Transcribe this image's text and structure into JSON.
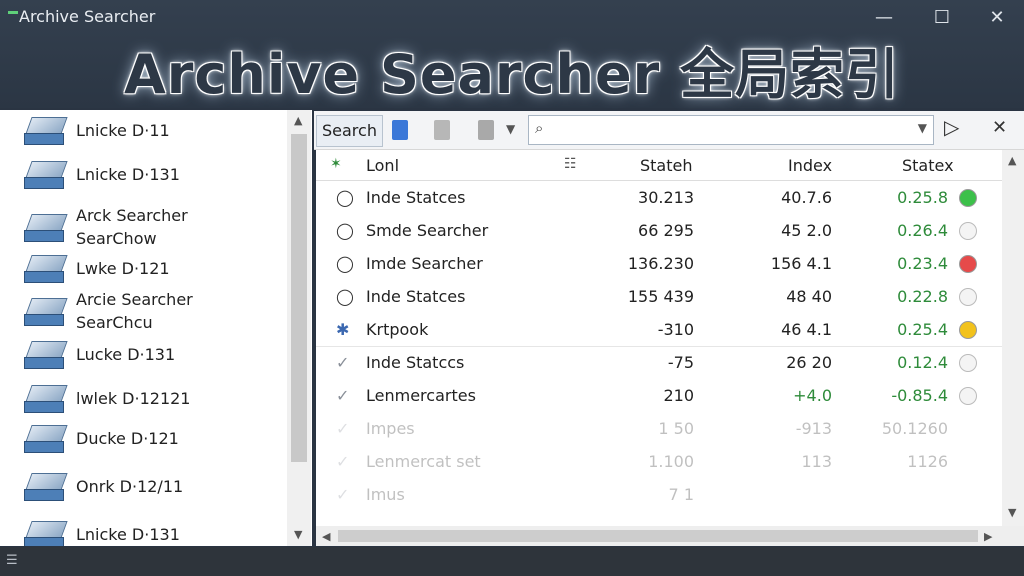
{
  "window": {
    "title": "Archive Searcher",
    "minimize": "—",
    "maximize": "☐",
    "close": "✕"
  },
  "banner": "Archive Searcher 全局索引",
  "sidebar": {
    "items": [
      {
        "label": "Lnicke D·11"
      },
      {
        "label": "Lnicke D·131"
      },
      {
        "label": "Arck Searcher\nSearChow"
      },
      {
        "label": "Lwke D·121"
      },
      {
        "label": "Arcie Searcher\nSearChcu"
      },
      {
        "label": "Lucke D·131"
      },
      {
        "label": "lwlek D·12121"
      },
      {
        "label": "Ducke D·121"
      },
      {
        "label": "Onrk D·12/11"
      },
      {
        "label": "Lnicke D·131"
      }
    ]
  },
  "toolbar": {
    "search_tab": "Search",
    "search_placeholder": "",
    "play": "▷",
    "close": "✕"
  },
  "table": {
    "headers": {
      "name": "Lonl",
      "stat": "Stateh",
      "index": "Index",
      "statex": "Statex"
    },
    "rows": [
      {
        "name": "Inde Statces",
        "stat": "30.213",
        "index": "40.7.6",
        "statex": "0.25.8",
        "status": "green"
      },
      {
        "name": "Smde Searcher",
        "stat": "66 295",
        "index": "45 2.0",
        "statex": "0.26.4",
        "status": "none"
      },
      {
        "name": "Imde Searcher",
        "stat": "136.230",
        "index": "156 4.1",
        "statex": "0.23.4",
        "status": "red"
      },
      {
        "name": "Inde Statces",
        "stat": "155 439",
        "index": "48 40",
        "statex": "0.22.8",
        "status": "none"
      },
      {
        "name": "Krtpook",
        "stat": "-310",
        "index": "46 4.1",
        "statex": "0.25.4",
        "status": "yellow"
      },
      {
        "name": "Inde Statccs",
        "stat": "-75",
        "index": "26 20",
        "statex": "0.12.4",
        "status": "none"
      },
      {
        "name": "Lenmercartes",
        "stat": "210",
        "index": "+4.0",
        "statex": "-0.85.4",
        "status": "none"
      },
      {
        "name": "Impes",
        "stat": "1 50",
        "index": "-913",
        "statex": "50.1260",
        "status": ""
      },
      {
        "name": "Lenmercat set",
        "stat": "1.100",
        "index": "113",
        "statex": "1126",
        "status": ""
      },
      {
        "name": "Imus",
        "stat": "7 1",
        "index": "",
        "statex": "",
        "status": ""
      }
    ]
  },
  "colors": {
    "green": "#3cc04a",
    "red": "#e64a4a",
    "yellow": "#f2c21c",
    "none": "#f4f4f4"
  }
}
